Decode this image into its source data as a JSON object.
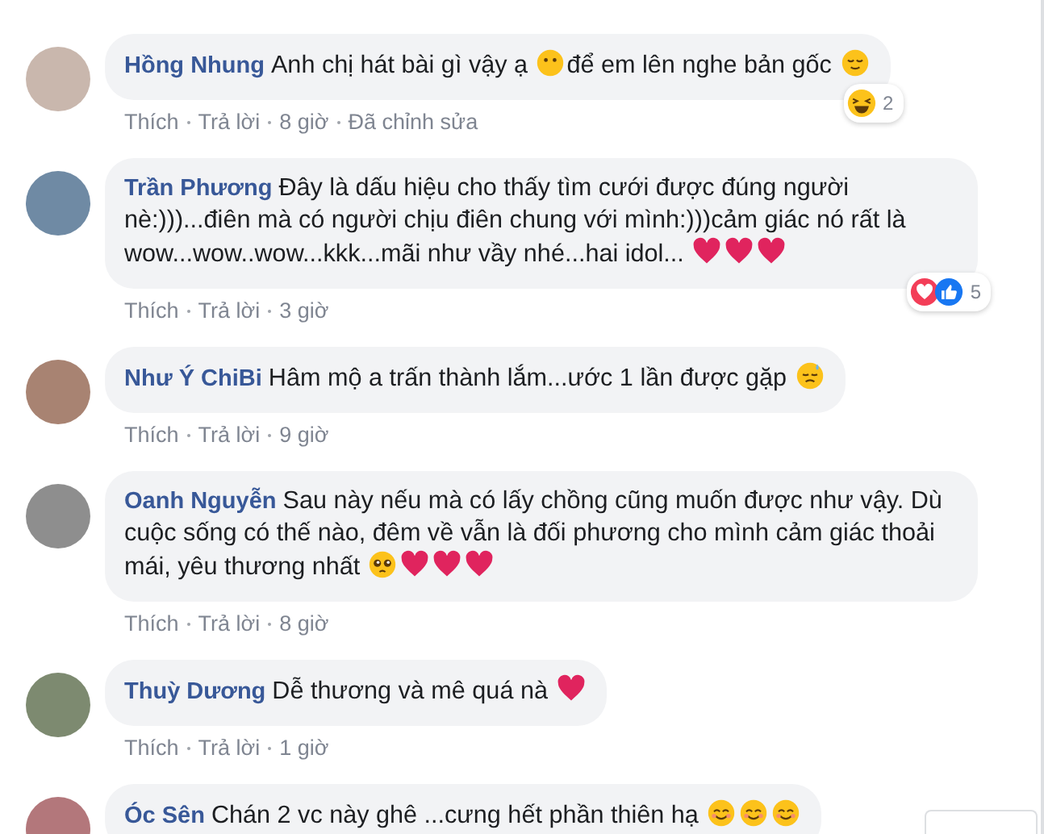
{
  "comments": [
    {
      "author": "Hồng Nhung",
      "segments": [
        {
          "kind": "text",
          "text": "Anh chị hát bài gì vậy ạ"
        },
        {
          "kind": "hush"
        },
        {
          "kind": "text",
          "text": "để em lên nghe bản gốc"
        },
        {
          "kind": "relieved"
        }
      ],
      "reactions": {
        "icons": [
          {
            "kind": "haha"
          }
        ],
        "count": "2"
      },
      "actions": {
        "like": "Thích",
        "reply": "Trả lời",
        "time": "8 giờ",
        "edited": "Đã chỉnh sửa"
      }
    },
    {
      "author": "Trần Phương",
      "segments": [
        {
          "kind": "text",
          "text": "Đây là dấu hiệu cho thấy tìm cưới được đúng người nè:)))...điên mà có người chịu điên chung với mình:)))cảm giác nó rất là wow...wow..wow...kkk...mãi như vầy nhé...hai idol..."
        },
        {
          "kind": "heart"
        },
        {
          "kind": "heart"
        },
        {
          "kind": "heart"
        }
      ],
      "reactions": {
        "icons": [
          {
            "kind": "love"
          },
          {
            "kind": "like"
          }
        ],
        "count": "5"
      },
      "actions": {
        "like": "Thích",
        "reply": "Trả lời",
        "time": "3 giờ"
      }
    },
    {
      "author": "Như Ý ChiBi",
      "segments": [
        {
          "kind": "text",
          "text": "Hâm mộ a trấn thành lắm...ước 1 lần được gặp"
        },
        {
          "kind": "sweat"
        }
      ],
      "actions": {
        "like": "Thích",
        "reply": "Trả lời",
        "time": "9 giờ"
      }
    },
    {
      "author": "Oanh Nguyễn",
      "segments": [
        {
          "kind": "text",
          "text": "Sau này nếu mà có lấy chồng cũng muốn được như vậy. Dù cuộc sống có thế nào, đêm về vẫn là đối phương cho mình cảm giác thoải mái, yêu thương nhất"
        },
        {
          "kind": "pleading"
        },
        {
          "kind": "heart"
        },
        {
          "kind": "heart"
        },
        {
          "kind": "heart"
        }
      ],
      "actions": {
        "like": "Thích",
        "reply": "Trả lời",
        "time": "8 giờ"
      }
    },
    {
      "author": "Thuỳ Dương",
      "segments": [
        {
          "kind": "text",
          "text": "Dễ thương và mê quá nà"
        },
        {
          "kind": "heart"
        }
      ],
      "actions": {
        "like": "Thích",
        "reply": "Trả lời",
        "time": "1 giờ"
      }
    },
    {
      "author": "Óc Sên",
      "segments": [
        {
          "kind": "text",
          "text": "Chán 2 vc này ghê ...cưng hết phần thiên hạ"
        },
        {
          "kind": "smile"
        },
        {
          "kind": "smile"
        },
        {
          "kind": "smile"
        }
      ]
    }
  ]
}
